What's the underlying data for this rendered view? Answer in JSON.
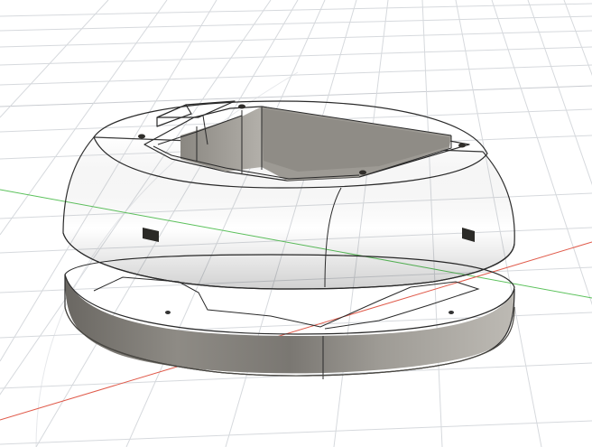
{
  "viewport": {
    "background": "#ffffff",
    "grid_color": "#d6d9dd",
    "x_axis_color": "#e05a4a",
    "y_axis_color": "#5cc25c"
  },
  "model": {
    "body_color_light": "#d9d6d0",
    "body_color_mid": "#9a978f",
    "body_color_dark": "#5e5b55",
    "edge_color": "#2a2a2a",
    "parts": [
      "upper-dome-shell",
      "base-plate"
    ]
  }
}
